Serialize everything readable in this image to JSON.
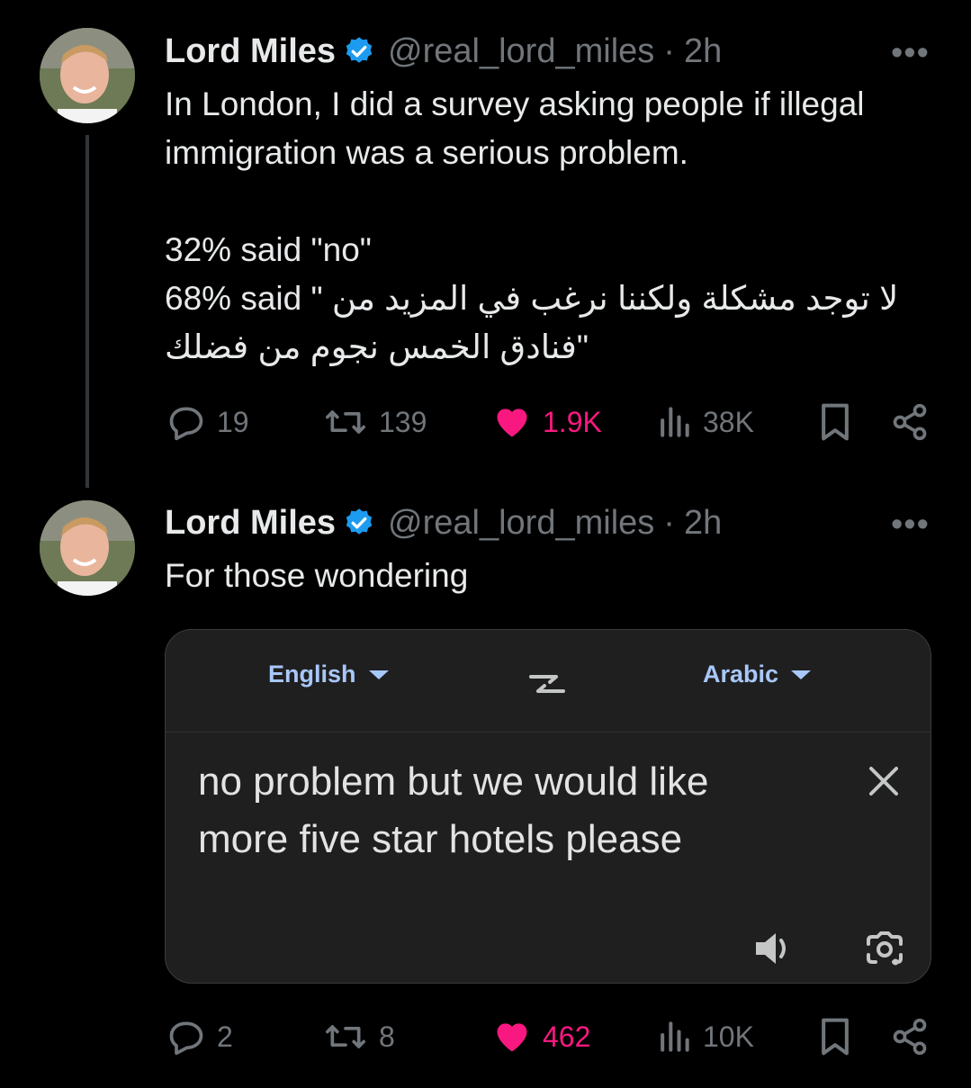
{
  "tweets": [
    {
      "author_name": "Lord Miles",
      "author_handle": "@real_lord_miles",
      "separator": "·",
      "time": "2h",
      "more": "•••",
      "lines": [
        "In London, I did a survey asking people if illegal immigration was a serious problem.",
        "32% said \"no\"",
        "68% said \" لا توجد مشكلة ولكننا نرغب في المزيد من فنادق الخمس نجوم من فضلك\""
      ],
      "metrics": {
        "replies": "19",
        "reposts": "139",
        "likes": "1.9K",
        "views": "38K"
      }
    },
    {
      "author_name": "Lord Miles",
      "author_handle": "@real_lord_miles",
      "separator": "·",
      "time": "2h",
      "more": "•••",
      "text": "For those wondering",
      "metrics": {
        "replies": "2",
        "reposts": "8",
        "likes": "462",
        "views": "10K"
      }
    }
  ],
  "translate_card": {
    "source_lang": "English",
    "target_lang": "Arabic",
    "text": "no problem but we would like more five star hotels please"
  },
  "colors": {
    "like": "#f91880",
    "verified": "#1d9bf0",
    "lang": "#a8c7fa"
  }
}
